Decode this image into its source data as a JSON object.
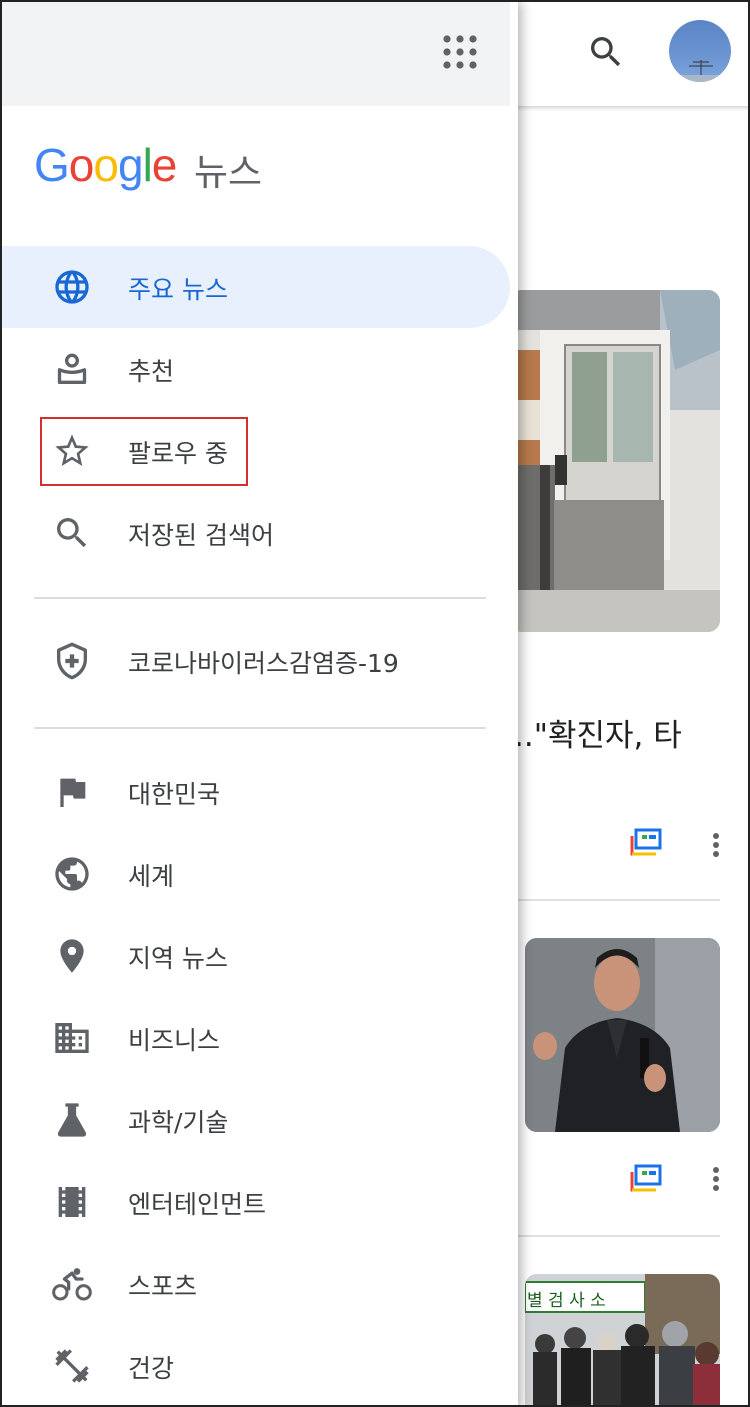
{
  "app": {
    "logo_letters": [
      "G",
      "o",
      "o",
      "g",
      "l",
      "e"
    ],
    "logo_colors": [
      "#4285F4",
      "#EA4335",
      "#FBBC05",
      "#4285F4",
      "#34A853",
      "#EA4335"
    ],
    "logo_suffix": "뉴스"
  },
  "header": {
    "apps_icon": "apps-grid-icon",
    "search_icon": "search-icon",
    "avatar": "account-avatar"
  },
  "nav": {
    "primary": [
      {
        "label": "주요 뉴스",
        "icon": "globe-icon",
        "active": true
      },
      {
        "label": "추천",
        "icon": "for-you-icon",
        "active": false
      },
      {
        "label": "팔로우 중",
        "icon": "star-icon",
        "active": false
      },
      {
        "label": "저장된 검색어",
        "icon": "search-icon",
        "active": false
      }
    ],
    "covid": {
      "label": "코로나바이러스감염증-19",
      "icon": "shield-plus-icon"
    },
    "sections": [
      {
        "label": "대한민국",
        "icon": "flag-icon"
      },
      {
        "label": "세계",
        "icon": "world-icon"
      },
      {
        "label": "지역 뉴스",
        "icon": "location-pin-icon"
      },
      {
        "label": "비즈니스",
        "icon": "business-building-icon"
      },
      {
        "label": "과학/기술",
        "icon": "flask-icon"
      },
      {
        "label": "엔터테인먼트",
        "icon": "film-icon"
      },
      {
        "label": "스포츠",
        "icon": "cyclist-icon"
      },
      {
        "label": "건강",
        "icon": "dumbbell-icon"
      }
    ]
  },
  "background": {
    "headline_fragment": "..\"확진자, 타",
    "img3_sign_text": "별 검 사 소"
  },
  "colors": {
    "active_bg": "#e8f0fe",
    "active_text": "#1967d2",
    "icon_grey": "#5f6368",
    "highlight_red": "#d32f2f"
  }
}
